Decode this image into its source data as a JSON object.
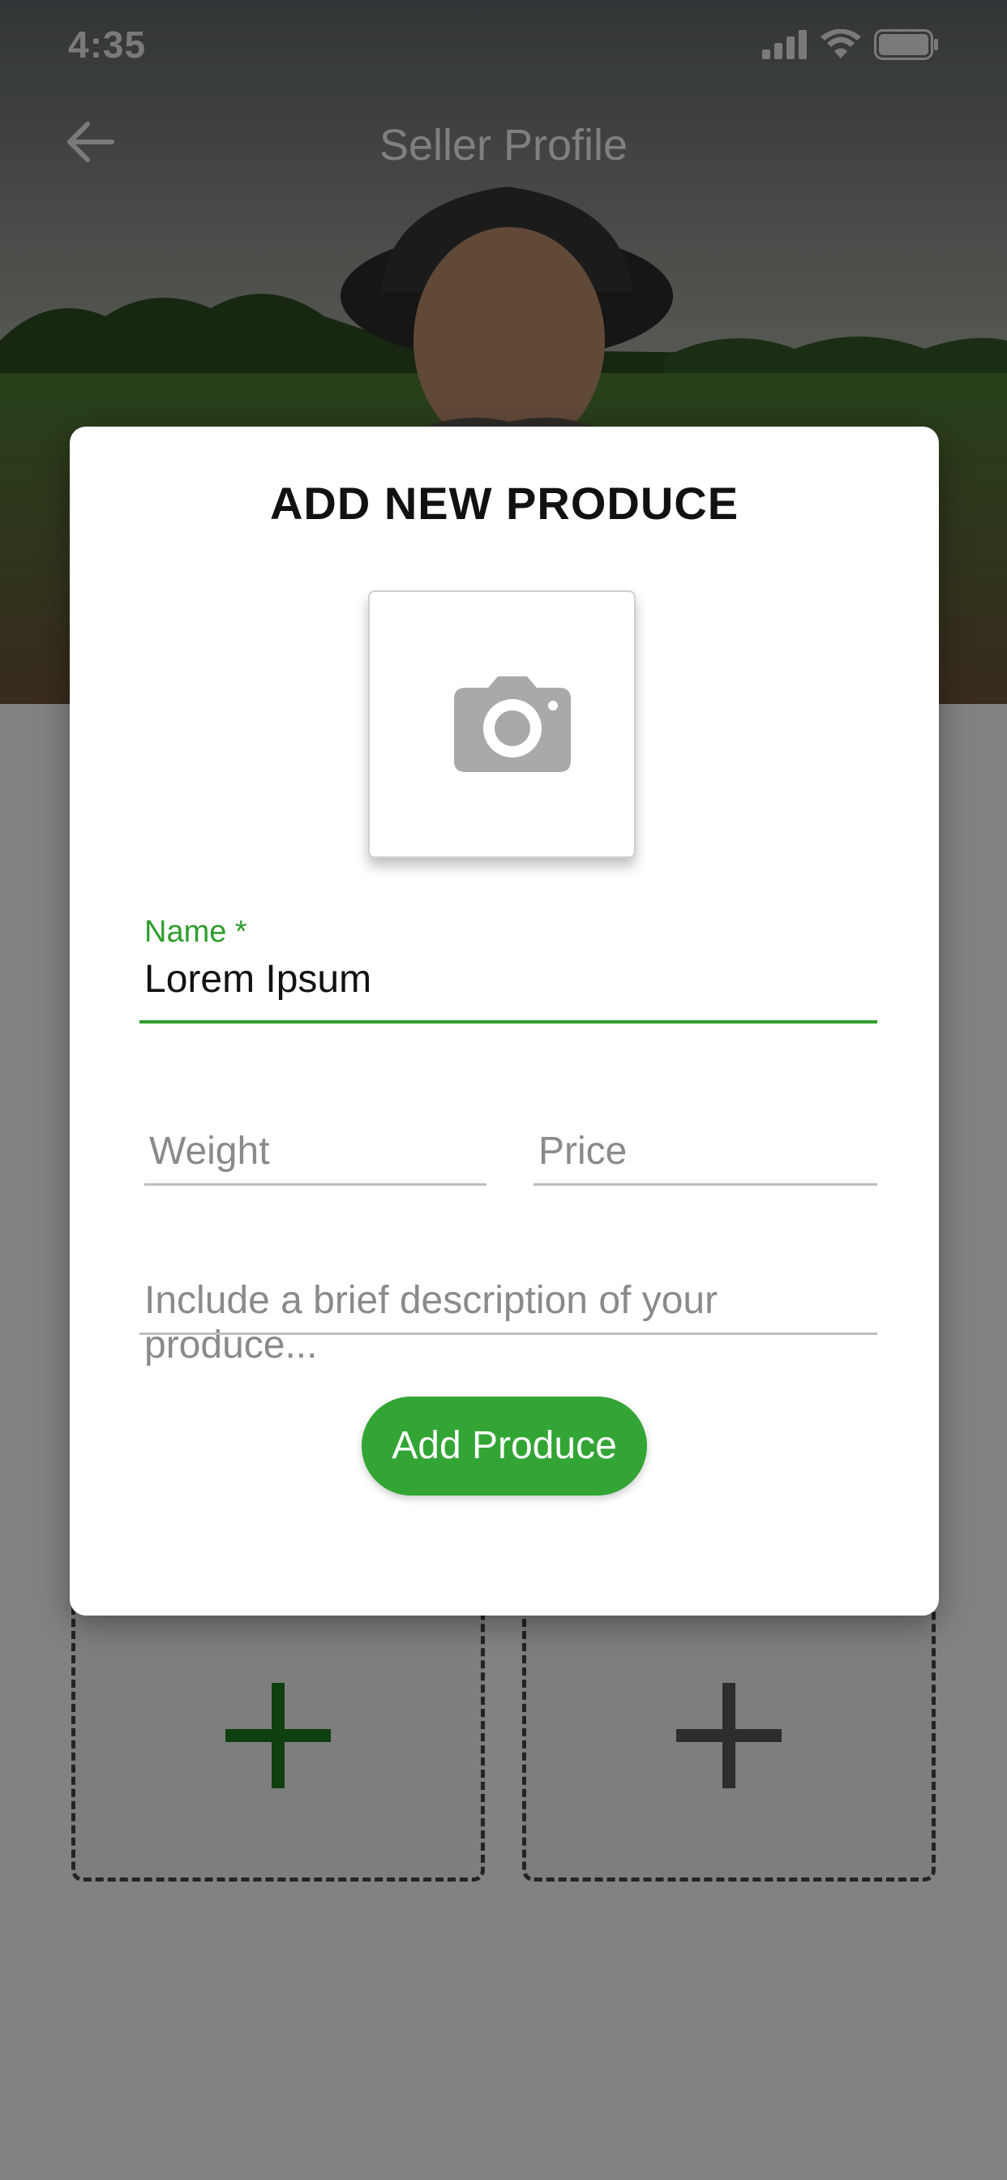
{
  "status_bar": {
    "time": "4:35"
  },
  "app_bar": {
    "title": "Seller Profile",
    "back_icon": "arrow-left-icon"
  },
  "modal": {
    "title": "ADD NEW PRODUCE",
    "photo_icon": "camera-icon",
    "name_field": {
      "label": "Name *",
      "value": "Lorem Ipsum"
    },
    "weight_field": {
      "placeholder": "Weight"
    },
    "price_field": {
      "placeholder": "Price"
    },
    "description_field": {
      "placeholder": "Include a brief description of your produce..."
    },
    "submit_label": "Add Produce"
  },
  "produce_slots": [
    {
      "icon": "plus-icon",
      "color": "#1e7a1e"
    },
    {
      "icon": "plus-icon",
      "color": "#555555"
    }
  ],
  "colors": {
    "accent": "#33a535",
    "label": "#2e9e2e"
  }
}
